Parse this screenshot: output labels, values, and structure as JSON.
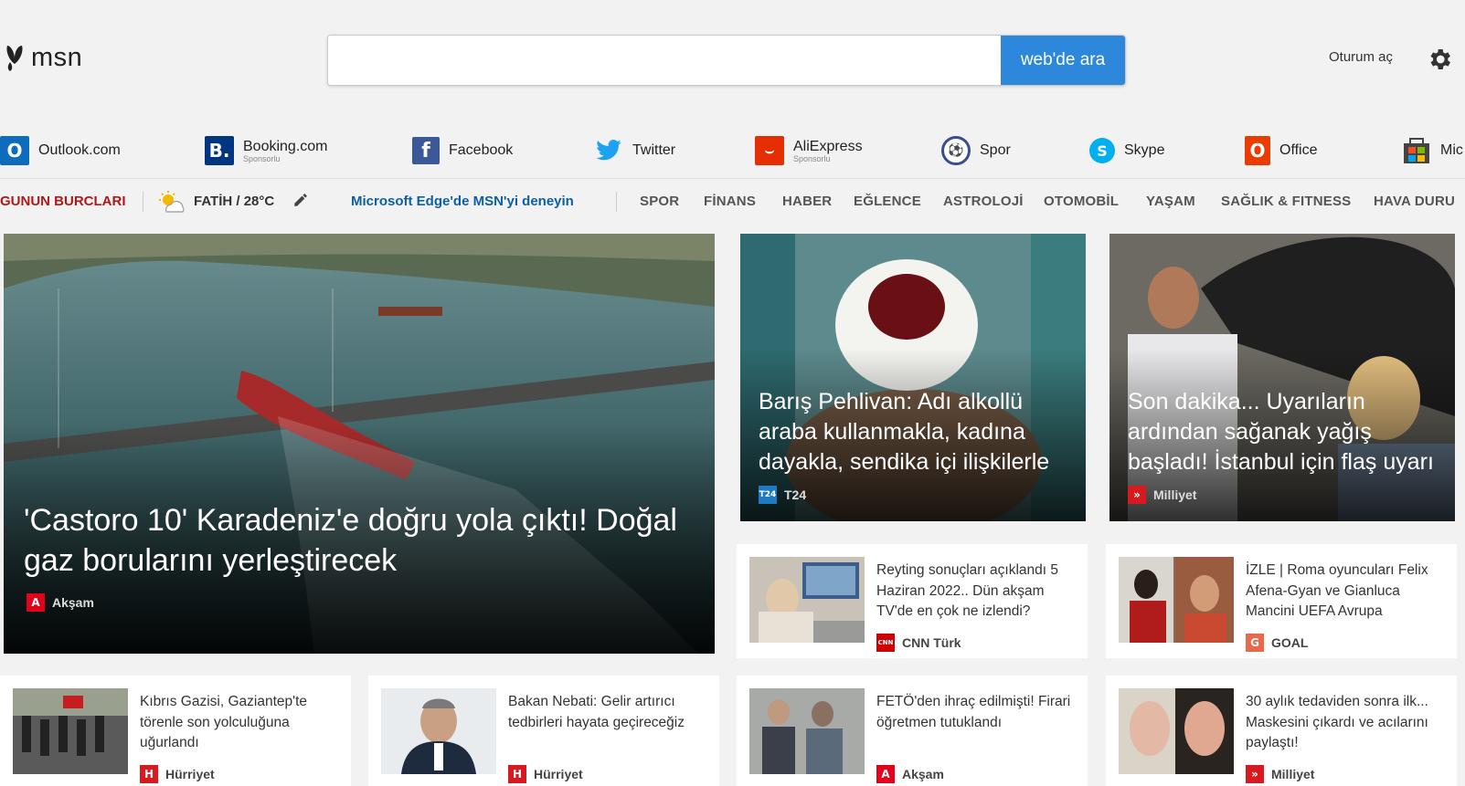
{
  "header": {
    "logo_text": "msn",
    "search_button": "web'de ara",
    "search_placeholder": "",
    "signin": "Oturum aç"
  },
  "quick_links": [
    {
      "label": "Outlook.com",
      "sub": "",
      "icon": "outlook-icon",
      "color": "#0f6cbd"
    },
    {
      "label": "Booking.com",
      "sub": "Sponsorlu",
      "icon": "booking-icon",
      "color": "#003580"
    },
    {
      "label": "Facebook",
      "sub": "",
      "icon": "facebook-icon",
      "color": "#3b5998"
    },
    {
      "label": "Twitter",
      "sub": "",
      "icon": "twitter-icon",
      "color": "#1da1f2"
    },
    {
      "label": "AliExpress",
      "sub": "Sponsorlu",
      "icon": "aliexpress-icon",
      "color": "#e62e04"
    },
    {
      "label": "Spor",
      "sub": "",
      "icon": "spor-icon",
      "color": "#3a4d8f"
    },
    {
      "label": "Skype",
      "sub": "",
      "icon": "skype-icon",
      "color": "#00aff0"
    },
    {
      "label": "Office",
      "sub": "",
      "icon": "office-icon",
      "color": "#eb3c00"
    },
    {
      "label": "Mic",
      "sub": "",
      "icon": "store-icon",
      "color": "#444"
    }
  ],
  "nav": {
    "burc": "GUNUN BURCLARI",
    "weather": "FATİH / 28°C",
    "edge": "Microsoft Edge'de MSN'yi deneyin",
    "items": [
      "SPOR",
      "FİNANS",
      "HABER",
      "EĞLENCE",
      "ASTROLOJİ",
      "OTOMOBİL",
      "YAŞAM",
      "SAĞLIK & FITNESS",
      "HAVA DURU"
    ]
  },
  "hero": {
    "title": "'Castoro 10' Karadeniz'e doğru yola çıktı! Doğal gaz borularını yerleştirecek",
    "source": "Akşam"
  },
  "image_cards": [
    {
      "title": "Barış Pehlivan: Adı alkollü araba kullanmakla, kadına dayakla, sendika içi ilişkilerle",
      "source": "T24",
      "logo": "T24",
      "logo_color": "#1f7bc1"
    },
    {
      "title": "Son dakika... Uyarıların ardından sağanak yağış başladı! İstanbul için flaş uyarı",
      "source": "Milliyet",
      "logo": "»",
      "logo_color": "#d71920"
    }
  ],
  "small_cards": [
    {
      "title": "Reyting sonuçları açıklandı 5 Haziran 2022.. Dün akşam TV'de en çok ne izlendi?",
      "source": "CNN Türk",
      "logo": "CNN",
      "logo_color": "#cc0000"
    },
    {
      "title": "İZLE | Roma oyuncuları Felix Afena-Gyan ve Gianluca Mancini UEFA Avrupa",
      "source": "GOAL",
      "logo": "G",
      "logo_color": "#e8684a"
    },
    {
      "title": "Kıbrıs Gazisi, Gaziantep'te törenle son yolculuğuna uğurlandı",
      "source": "Hürriyet",
      "logo": "H",
      "logo_color": "#d71920"
    },
    {
      "title": "Bakan Nebati: Gelir artırıcı tedbirleri hayata geçireceğiz",
      "source": "Hürriyet",
      "logo": "H",
      "logo_color": "#d71920"
    },
    {
      "title": "FETÖ'den ihraç edilmişti! Firari öğretmen tutuklandı",
      "source": "Akşam",
      "logo": "A",
      "logo_color": "#e2001a"
    },
    {
      "title": "30 aylık tedaviden sonra ilk... Maskesini çıkardı ve acılarını paylaştı!",
      "source": "Milliyet",
      "logo": "»",
      "logo_color": "#d71920"
    }
  ],
  "colors": {
    "accent": "#2d88db",
    "burc": "#b01818",
    "edge_link": "#0b5fa8"
  }
}
